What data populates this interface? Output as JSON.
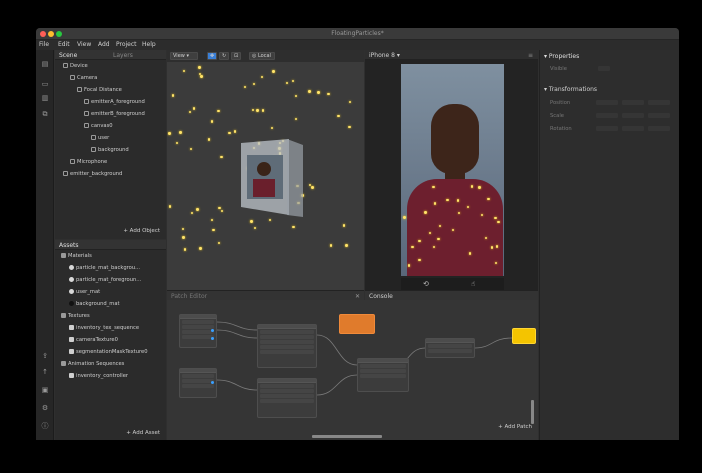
{
  "window": {
    "title": "FloatingParticles*"
  },
  "menu": [
    "File",
    "Edit",
    "View",
    "Add",
    "Project",
    "Help"
  ],
  "scene_panel": {
    "tabs": [
      "Scene",
      "Layers"
    ],
    "tree": [
      {
        "label": "Device",
        "indent": 0
      },
      {
        "label": "Camera",
        "indent": 1
      },
      {
        "label": "Focal Distance",
        "indent": 2
      },
      {
        "label": "emitterA_foreground",
        "indent": 3
      },
      {
        "label": "emitterB_foreground",
        "indent": 3
      },
      {
        "label": "canvas0",
        "indent": 3
      },
      {
        "label": "user",
        "indent": 4
      },
      {
        "label": "background",
        "indent": 4
      },
      {
        "label": "Microphone",
        "indent": 1
      },
      {
        "label": "emitter_background",
        "indent": 0
      }
    ],
    "add_object": "+ Add Object"
  },
  "assets_panel": {
    "title": "Assets",
    "tree": [
      {
        "label": "Materials",
        "indent": 0,
        "type": "folder"
      },
      {
        "label": "particle_mat_backgrou...",
        "indent": 1,
        "type": "mat"
      },
      {
        "label": "particle_mat_foregroun...",
        "indent": 1,
        "type": "mat"
      },
      {
        "label": "user_mat",
        "indent": 1,
        "type": "mat"
      },
      {
        "label": "background_mat",
        "indent": 1,
        "type": "mat-dark"
      },
      {
        "label": "Textures",
        "indent": 0,
        "type": "folder"
      },
      {
        "label": "inventory_tex_sequence",
        "indent": 1,
        "type": "tex"
      },
      {
        "label": "cameraTexture0",
        "indent": 1,
        "type": "tex"
      },
      {
        "label": "segmentationMaskTexture0",
        "indent": 1,
        "type": "tex"
      },
      {
        "label": "Animation Sequences",
        "indent": 0,
        "type": "folder"
      },
      {
        "label": "inventory_controller",
        "indent": 1,
        "type": "tex"
      }
    ],
    "add_asset": "+ Add Asset"
  },
  "viewport": {
    "view_label": "View",
    "local_label": "Local"
  },
  "simulator": {
    "device": "iPhone 8"
  },
  "properties": {
    "title": "Properties",
    "section": "Transformations",
    "fields": [
      "Position",
      "Scale",
      "Rotation"
    ]
  },
  "patch_editor": {
    "add_patch": "+ Add Patch"
  },
  "colors": {
    "accent": "#3aa0ff",
    "particle": "#ffe46a",
    "patch_orange": "#e07b2c",
    "patch_yellow": "#f4c400"
  }
}
